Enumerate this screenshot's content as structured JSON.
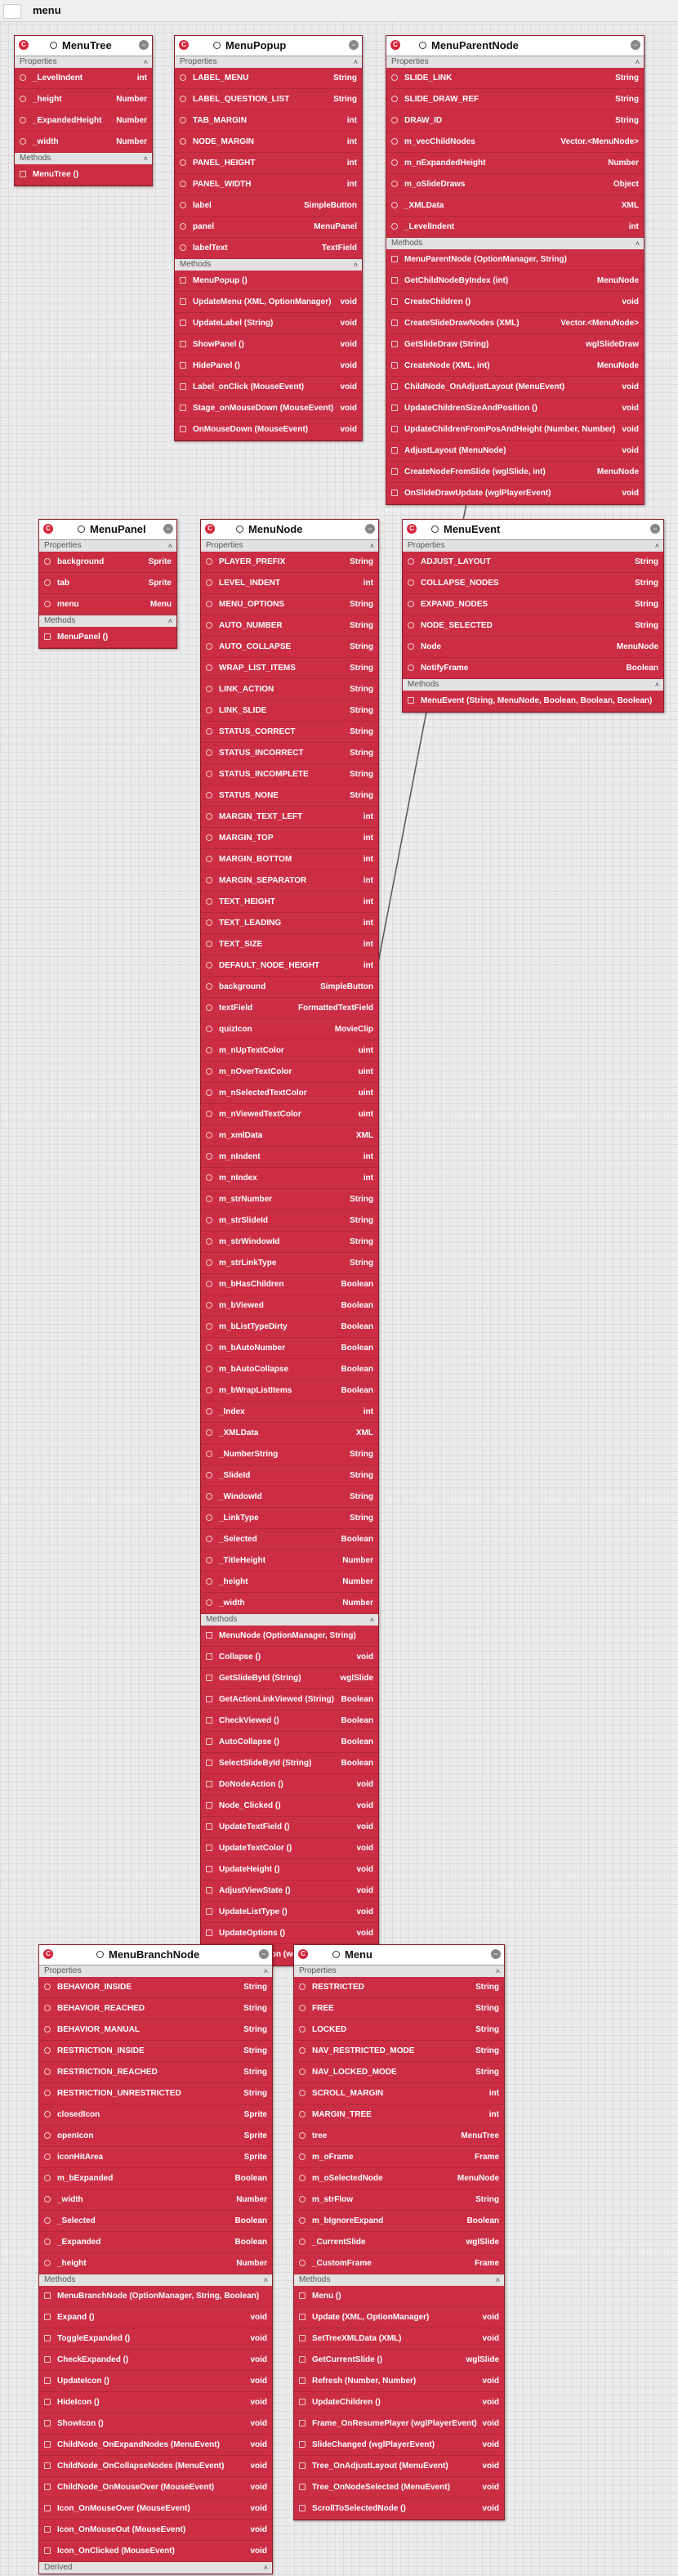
{
  "app": {
    "title": "menu"
  },
  "labels": {
    "properties": "Properties",
    "methods": "Methods",
    "derived": "Derived"
  },
  "classes": [
    {
      "id": "menutree",
      "name": "MenuTree",
      "properties": [
        {
          "n": "_LevelIndent",
          "t": "int"
        },
        {
          "n": "_height",
          "t": "Number"
        },
        {
          "n": "_ExpandedHeight",
          "t": "Number"
        },
        {
          "n": "_width",
          "t": "Number"
        }
      ],
      "methods": [
        {
          "n": "MenuTree ()",
          "t": ""
        }
      ]
    },
    {
      "id": "menupopup",
      "name": "MenuPopup",
      "properties": [
        {
          "n": "LABEL_MENU",
          "t": "String"
        },
        {
          "n": "LABEL_QUESTION_LIST",
          "t": "String"
        },
        {
          "n": "TAB_MARGIN",
          "t": "int"
        },
        {
          "n": "NODE_MARGIN",
          "t": "int"
        },
        {
          "n": "PANEL_HEIGHT",
          "t": "int"
        },
        {
          "n": "PANEL_WIDTH",
          "t": "int"
        },
        {
          "n": "label",
          "t": "SimpleButton"
        },
        {
          "n": "panel",
          "t": "MenuPanel"
        },
        {
          "n": "labelText",
          "t": "TextField"
        }
      ],
      "methods": [
        {
          "n": "MenuPopup ()",
          "t": ""
        },
        {
          "n": "UpdateMenu (XML, OptionManager)",
          "t": "void"
        },
        {
          "n": "UpdateLabel (String)",
          "t": "void"
        },
        {
          "n": "ShowPanel ()",
          "t": "void"
        },
        {
          "n": "HidePanel ()",
          "t": "void"
        },
        {
          "n": "Label_onClick (MouseEvent)",
          "t": "void"
        },
        {
          "n": "Stage_onMouseDown (MouseEvent)",
          "t": "void"
        },
        {
          "n": "OnMouseDown (MouseEvent)",
          "t": "void"
        }
      ]
    },
    {
      "id": "menuparentnode",
      "name": "MenuParentNode",
      "properties": [
        {
          "n": "SLIDE_LINK",
          "t": "String"
        },
        {
          "n": "SLIDE_DRAW_REF",
          "t": "String"
        },
        {
          "n": "DRAW_ID",
          "t": "String"
        },
        {
          "n": "m_vecChildNodes",
          "t": "Vector.<MenuNode>"
        },
        {
          "n": "m_nExpandedHeight",
          "t": "Number"
        },
        {
          "n": "m_oSlideDraws",
          "t": "Object"
        },
        {
          "n": "_XMLData",
          "t": "XML"
        },
        {
          "n": "_LevelIndent",
          "t": "int"
        }
      ],
      "methods": [
        {
          "n": "MenuParentNode (OptionManager, String)",
          "t": ""
        },
        {
          "n": "GetChildNodeByIndex (int)",
          "t": "MenuNode"
        },
        {
          "n": "CreateChildren ()",
          "t": "void"
        },
        {
          "n": "CreateSlideDrawNodes (XML)",
          "t": "Vector.<MenuNode>"
        },
        {
          "n": "GetSlideDraw (String)",
          "t": "wglSlideDraw"
        },
        {
          "n": "CreateNode (XML, int)",
          "t": "MenuNode"
        },
        {
          "n": "ChildNode_OnAdjustLayout (MenuEvent)",
          "t": "void"
        },
        {
          "n": "UpdateChildrenSizeAndPosition ()",
          "t": "void"
        },
        {
          "n": "UpdateChildrenFromPosAndHeight (Number, Number)",
          "t": "void"
        },
        {
          "n": "AdjustLayout (MenuNode)",
          "t": "void"
        },
        {
          "n": "CreateNodeFromSlide (wglSlide, int)",
          "t": "MenuNode"
        },
        {
          "n": "OnSlideDrawUpdate (wglPlayerEvent)",
          "t": "void"
        }
      ]
    },
    {
      "id": "menupanel",
      "name": "MenuPanel",
      "properties": [
        {
          "n": "background",
          "t": "Sprite"
        },
        {
          "n": "tab",
          "t": "Sprite"
        },
        {
          "n": "menu",
          "t": "Menu"
        }
      ],
      "methods": [
        {
          "n": "MenuPanel ()",
          "t": ""
        }
      ]
    },
    {
      "id": "menunode",
      "name": "MenuNode",
      "properties": [
        {
          "n": "PLAYER_PREFIX",
          "t": "String"
        },
        {
          "n": "LEVEL_INDENT",
          "t": "int"
        },
        {
          "n": "MENU_OPTIONS",
          "t": "String"
        },
        {
          "n": "AUTO_NUMBER",
          "t": "String"
        },
        {
          "n": "AUTO_COLLAPSE",
          "t": "String"
        },
        {
          "n": "WRAP_LIST_ITEMS",
          "t": "String"
        },
        {
          "n": "LINK_ACTION",
          "t": "String"
        },
        {
          "n": "LINK_SLIDE",
          "t": "String"
        },
        {
          "n": "STATUS_CORRECT",
          "t": "String"
        },
        {
          "n": "STATUS_INCORRECT",
          "t": "String"
        },
        {
          "n": "STATUS_INCOMPLETE",
          "t": "String"
        },
        {
          "n": "STATUS_NONE",
          "t": "String"
        },
        {
          "n": "MARGIN_TEXT_LEFT",
          "t": "int"
        },
        {
          "n": "MARGIN_TOP",
          "t": "int"
        },
        {
          "n": "MARGIN_BOTTOM",
          "t": "int"
        },
        {
          "n": "MARGIN_SEPARATOR",
          "t": "int"
        },
        {
          "n": "TEXT_HEIGHT",
          "t": "int"
        },
        {
          "n": "TEXT_LEADING",
          "t": "int"
        },
        {
          "n": "TEXT_SIZE",
          "t": "int"
        },
        {
          "n": "DEFAULT_NODE_HEIGHT",
          "t": "int"
        },
        {
          "n": "background",
          "t": "SimpleButton"
        },
        {
          "n": "textField",
          "t": "FormattedTextField"
        },
        {
          "n": "quizIcon",
          "t": "MovieClip"
        },
        {
          "n": "m_nUpTextColor",
          "t": "uint"
        },
        {
          "n": "m_nOverTextColor",
          "t": "uint"
        },
        {
          "n": "m_nSelectedTextColor",
          "t": "uint"
        },
        {
          "n": "m_nViewedTextColor",
          "t": "uint"
        },
        {
          "n": "m_xmlData",
          "t": "XML"
        },
        {
          "n": "m_nIndent",
          "t": "int"
        },
        {
          "n": "m_nIndex",
          "t": "int"
        },
        {
          "n": "m_strNumber",
          "t": "String"
        },
        {
          "n": "m_strSlideId",
          "t": "String"
        },
        {
          "n": "m_strWindowId",
          "t": "String"
        },
        {
          "n": "m_strLinkType",
          "t": "String"
        },
        {
          "n": "m_bHasChildren",
          "t": "Boolean"
        },
        {
          "n": "m_bViewed",
          "t": "Boolean"
        },
        {
          "n": "m_bListTypeDirty",
          "t": "Boolean"
        },
        {
          "n": "m_bAutoNumber",
          "t": "Boolean"
        },
        {
          "n": "m_bAutoCollapse",
          "t": "Boolean"
        },
        {
          "n": "m_bWrapListItems",
          "t": "Boolean"
        },
        {
          "n": "_Index",
          "t": "int"
        },
        {
          "n": "_XMLData",
          "t": "XML"
        },
        {
          "n": "_NumberString",
          "t": "String"
        },
        {
          "n": "_SlideId",
          "t": "String"
        },
        {
          "n": "_WindowId",
          "t": "String"
        },
        {
          "n": "_LinkType",
          "t": "String"
        },
        {
          "n": "_Selected",
          "t": "Boolean"
        },
        {
          "n": "_TitleHeight",
          "t": "Number"
        },
        {
          "n": "_height",
          "t": "Number"
        },
        {
          "n": "_width",
          "t": "Number"
        }
      ],
      "methods": [
        {
          "n": "MenuNode (OptionManager, String)",
          "t": ""
        },
        {
          "n": "Collapse ()",
          "t": "void"
        },
        {
          "n": "GetSlideById (String)",
          "t": "wglSlide"
        },
        {
          "n": "GetActionLinkViewed (String)",
          "t": "Boolean"
        },
        {
          "n": "CheckViewed ()",
          "t": "Boolean"
        },
        {
          "n": "AutoCollapse ()",
          "t": "Boolean"
        },
        {
          "n": "SelectSlideById (String)",
          "t": "Boolean"
        },
        {
          "n": "DoNodeAction ()",
          "t": "void"
        },
        {
          "n": "Node_Clicked ()",
          "t": "void"
        },
        {
          "n": "UpdateTextField ()",
          "t": "void"
        },
        {
          "n": "UpdateTextColor ()",
          "t": "void"
        },
        {
          "n": "UpdateHeight ()",
          "t": "void"
        },
        {
          "n": "AdjustViewState ()",
          "t": "void"
        },
        {
          "n": "UpdateListType ()",
          "t": "void"
        },
        {
          "n": "UpdateOptions ()",
          "t": "void"
        },
        {
          "n": "UpdateQuizIcon (wglPlayerEvent)",
          "t": "void"
        }
      ]
    },
    {
      "id": "menuevent",
      "name": "MenuEvent",
      "properties": [
        {
          "n": "ADJUST_LAYOUT",
          "t": "String"
        },
        {
          "n": "COLLAPSE_NODES",
          "t": "String"
        },
        {
          "n": "EXPAND_NODES",
          "t": "String"
        },
        {
          "n": "NODE_SELECTED",
          "t": "String"
        },
        {
          "n": "Node",
          "t": "MenuNode"
        },
        {
          "n": "NotifyFrame",
          "t": "Boolean"
        }
      ],
      "methods": [
        {
          "n": "MenuEvent (String, MenuNode, Boolean, Boolean, Boolean)",
          "t": ""
        }
      ]
    },
    {
      "id": "menubranchnode",
      "name": "MenuBranchNode",
      "properties": [
        {
          "n": "BEHAVIOR_INSIDE",
          "t": "String"
        },
        {
          "n": "BEHAVIOR_REACHED",
          "t": "String"
        },
        {
          "n": "BEHAVIOR_MANUAL",
          "t": "String"
        },
        {
          "n": "RESTRICTION_INSIDE",
          "t": "String"
        },
        {
          "n": "RESTRICTION_REACHED",
          "t": "String"
        },
        {
          "n": "RESTRICTION_UNRESTRICTED",
          "t": "String"
        },
        {
          "n": "closedIcon",
          "t": "Sprite"
        },
        {
          "n": "openIcon",
          "t": "Sprite"
        },
        {
          "n": "iconHitArea",
          "t": "Sprite"
        },
        {
          "n": "m_bExpanded",
          "t": "Boolean"
        },
        {
          "n": "_width",
          "t": "Number"
        },
        {
          "n": "_Selected",
          "t": "Boolean"
        },
        {
          "n": "_Expanded",
          "t": "Boolean"
        },
        {
          "n": "_height",
          "t": "Number"
        }
      ],
      "methods": [
        {
          "n": "MenuBranchNode (OptionManager, String, Boolean)",
          "t": ""
        },
        {
          "n": "Expand ()",
          "t": "void"
        },
        {
          "n": "ToggleExpanded ()",
          "t": "void"
        },
        {
          "n": "CheckExpanded ()",
          "t": "void"
        },
        {
          "n": "UpdateIcon ()",
          "t": "void"
        },
        {
          "n": "HideIcon ()",
          "t": "void"
        },
        {
          "n": "ShowIcon ()",
          "t": "void"
        },
        {
          "n": "ChildNode_OnExpandNodes (MenuEvent)",
          "t": "void"
        },
        {
          "n": "ChildNode_OnCollapseNodes (MenuEvent)",
          "t": "void"
        },
        {
          "n": "ChildNode_OnMouseOver (MouseEvent)",
          "t": "void"
        },
        {
          "n": "Icon_OnMouseOver (MouseEvent)",
          "t": "void"
        },
        {
          "n": "Icon_OnMouseOut (MouseEvent)",
          "t": "void"
        },
        {
          "n": "Icon_OnClicked (MouseEvent)",
          "t": "void"
        }
      ],
      "derived": true
    },
    {
      "id": "menu",
      "name": "Menu",
      "properties": [
        {
          "n": "RESTRICTED",
          "t": "String"
        },
        {
          "n": "FREE",
          "t": "String"
        },
        {
          "n": "LOCKED",
          "t": "String"
        },
        {
          "n": "NAV_RESTRICTED_MODE",
          "t": "String"
        },
        {
          "n": "NAV_LOCKED_MODE",
          "t": "String"
        },
        {
          "n": "SCROLL_MARGIN",
          "t": "int"
        },
        {
          "n": "MARGIN_TREE",
          "t": "int"
        },
        {
          "n": "tree",
          "t": "MenuTree"
        },
        {
          "n": "m_oFrame",
          "t": "Frame"
        },
        {
          "n": "m_oSelectedNode",
          "t": "MenuNode"
        },
        {
          "n": "m_strFlow",
          "t": "String"
        },
        {
          "n": "m_bIgnoreExpand",
          "t": "Boolean"
        },
        {
          "n": "_CurrentSlide",
          "t": "wglSlide"
        },
        {
          "n": "_CustomFrame",
          "t": "Frame"
        }
      ],
      "methods": [
        {
          "n": "Menu ()",
          "t": ""
        },
        {
          "n": "Update (XML, OptionManager)",
          "t": "void"
        },
        {
          "n": "SetTreeXMLData (XML)",
          "t": "void"
        },
        {
          "n": "GetCurrentSlide ()",
          "t": "wglSlide"
        },
        {
          "n": "Refresh (Number, Number)",
          "t": "void"
        },
        {
          "n": "UpdateChildren ()",
          "t": "void"
        },
        {
          "n": "Frame_OnResumePlayer (wglPlayerEvent)",
          "t": "void"
        },
        {
          "n": "SlideChanged (wglPlayerEvent)",
          "t": "void"
        },
        {
          "n": "Tree_OnAdjustLayout (MenuEvent)",
          "t": "void"
        },
        {
          "n": "Tree_OnNodeSelected (MenuEvent)",
          "t": "void"
        },
        {
          "n": "ScrollToSelectedNode ()",
          "t": "void"
        }
      ]
    }
  ]
}
